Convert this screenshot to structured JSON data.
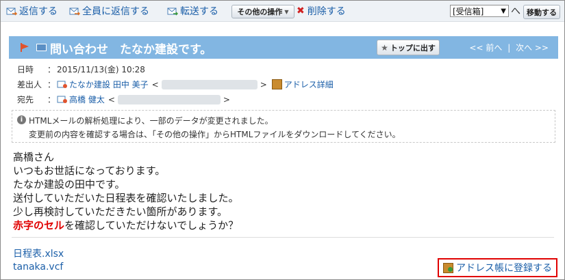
{
  "toolbar": {
    "reply": "返信する",
    "reply_all": "全員に返信する",
    "forward": "転送する",
    "other_ops": "その他の操作",
    "delete": "削除する",
    "folder_selected": "[受信箱]",
    "to_label": "へ",
    "move": "移動する"
  },
  "header": {
    "subject": "問い合わせ　たなか建設です。",
    "pin_top": "トップに出す",
    "prev": "<< 前へ",
    "divider": "|",
    "next": "次へ >>"
  },
  "meta": {
    "date_label": "日時",
    "colon": "：",
    "date_value": "2015/11/13(金) 10:28",
    "from_label": "差出人",
    "from_name": "たなか建設 田中 美子",
    "lt": "<",
    "gt": ">",
    "address_detail": "アドレス詳細",
    "to_label": "宛先",
    "to_name": "高橋 健太"
  },
  "notice": {
    "line1": "HTMLメールの解析処理により、一部のデータが変更されました。",
    "line2": "変更前の内容を確認する場合は、「その他の操作」からHTMLファイルをダウンロードしてください。"
  },
  "body": {
    "l1": "高橋さん",
    "l2": "いつもお世話になっております。",
    "l3": "たなか建設の田中です。",
    "l4": "送付していただいた日程表を確認いたしました。",
    "l5": "少し再検討していただきたい箇所があります。",
    "l6_red": "赤字のセル",
    "l6_rest": "を確認していただけないでしょうか？"
  },
  "attachments": [
    "日程表.xlsx",
    "tanaka.vcf"
  ],
  "register_button": "アドレス帳に登録する",
  "colors": {
    "link": "#1a5ea8",
    "header_bar": "#82b6e2",
    "highlight": "#e00000"
  }
}
